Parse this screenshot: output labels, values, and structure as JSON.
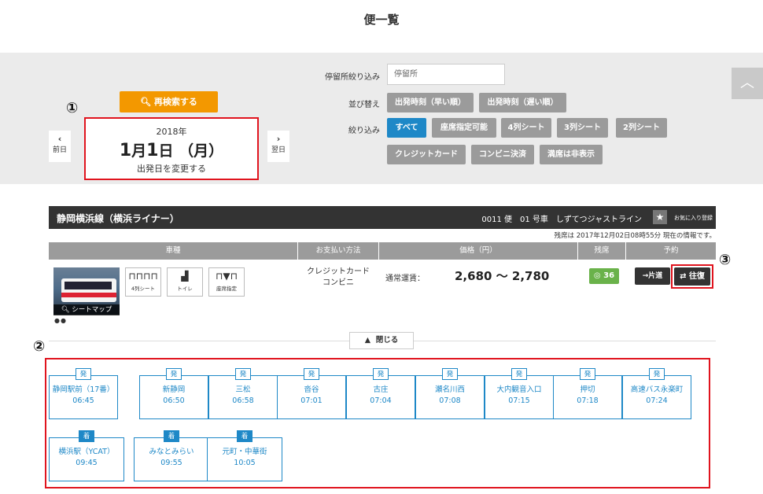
{
  "page": {
    "title": "便一覧"
  },
  "markers": {
    "m1": "①",
    "m2": "②",
    "m3": "③"
  },
  "search": {
    "research_label": "再検索する",
    "date": {
      "year": "2018年",
      "month": "1",
      "month_suffix": "月",
      "day": "1",
      "day_suffix": "日",
      "weekday": "（月）",
      "change_label": "出発日を変更する"
    },
    "prev_label": "前日",
    "next_label": "翌日",
    "stop_filter_label": "停留所絞り込み",
    "stop_filter_placeholder": "停留所",
    "sort_label": "並び替え",
    "sort_options": [
      "出発時刻（早い順）",
      "出発時刻（遅い順）"
    ],
    "filter_label": "絞り込み",
    "filter_options": [
      "すべて",
      "座席指定可能",
      "4列シート",
      "3列シート",
      "2列シート",
      "クレジットカード",
      "コンビニ決済",
      "満席は非表示"
    ]
  },
  "trip": {
    "route_name": "静岡横浜線（横浜ライナー）",
    "info": "0011 便　01 号車　しずてつジャストライン",
    "favorite_label": "お気に入り登録",
    "remaining_note": "残席は 2017年12月02日08時55分 現在の情報です。",
    "headers": [
      "車種",
      "お支払い方法",
      "価格（円）",
      "残席",
      "予約"
    ],
    "features": [
      "4列シート",
      "トイレ",
      "座席指定"
    ],
    "seatmap_label": "シートマップ",
    "payment": [
      "クレジットカード",
      "コンビニ"
    ],
    "fare_label": "通常運賃：",
    "fare_value": "2,680 ～ 2,780",
    "seats_left": "36",
    "oneway_label": "片道",
    "roundtrip_label": "往復",
    "close_label": "閉じる"
  },
  "departures": [
    {
      "tag": "発",
      "name": "静岡駅前（17番）",
      "time": "06:45"
    },
    {
      "tag": "発",
      "name": "新静岡",
      "time": "06:50"
    },
    {
      "tag": "発",
      "name": "三松",
      "time": "06:58"
    },
    {
      "tag": "発",
      "name": "沓谷",
      "time": "07:01"
    },
    {
      "tag": "発",
      "name": "古庄",
      "time": "07:04"
    },
    {
      "tag": "発",
      "name": "瀬名川西",
      "time": "07:08"
    },
    {
      "tag": "発",
      "name": "大内観音入口",
      "time": "07:15"
    },
    {
      "tag": "発",
      "name": "押切",
      "time": "07:18"
    },
    {
      "tag": "発",
      "name": "高速バス永楽町",
      "time": "07:24"
    }
  ],
  "arrivals": [
    {
      "tag": "着",
      "name": "横浜駅（YCAT）",
      "time": "09:45"
    },
    {
      "tag": "着",
      "name": "みなとみらい",
      "time": "09:55"
    },
    {
      "tag": "着",
      "name": "元町・中華街",
      "time": "10:05"
    }
  ],
  "colors": {
    "accent_blue": "#1e88c7",
    "orange": "#f39800",
    "highlight_red": "#e0141e",
    "seat_green": "#6ab24a"
  }
}
